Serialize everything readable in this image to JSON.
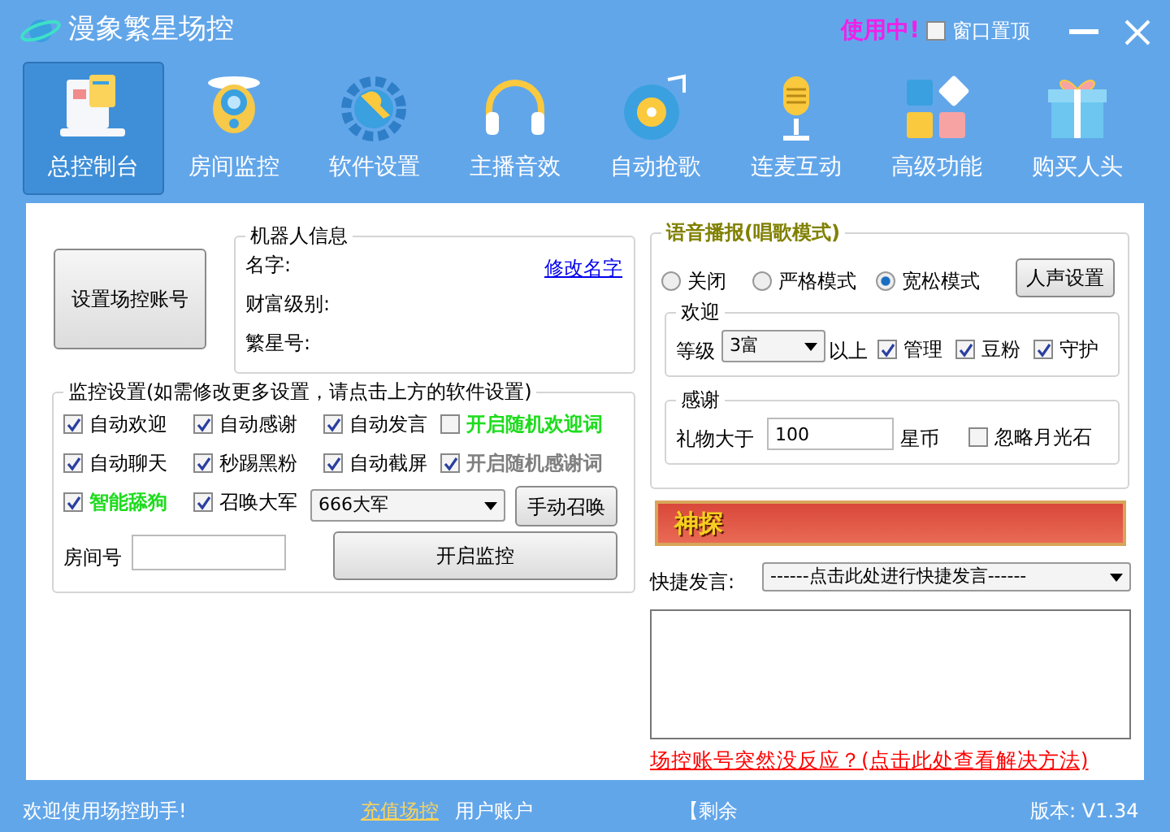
{
  "window": {
    "title": "漫象繁星场控",
    "status_badge": "使用中!",
    "pin_on_top": {
      "label": "窗口置顶",
      "checked": false
    }
  },
  "toolbar": [
    {
      "label": "总控制台",
      "selected": true
    },
    {
      "label": "房间监控",
      "selected": false
    },
    {
      "label": "软件设置",
      "selected": false
    },
    {
      "label": "主播音效",
      "selected": false
    },
    {
      "label": "自动抢歌",
      "selected": false
    },
    {
      "label": "连麦互动",
      "selected": false
    },
    {
      "label": "高级功能",
      "selected": false
    },
    {
      "label": "购买人头",
      "selected": false
    }
  ],
  "account_button": "设置场控账号",
  "robot_info": {
    "title": "机器人信息",
    "fields": [
      "名字:",
      "财富级别:",
      "繁星号:"
    ],
    "rename_link": "修改名字"
  },
  "monitor": {
    "title": "监控设置(如需修改更多设置，请点击上方的软件设置)",
    "options": [
      {
        "label": "自动欢迎",
        "checked": true,
        "highlight": false,
        "disabled": false
      },
      {
        "label": "自动感谢",
        "checked": true,
        "highlight": false,
        "disabled": false
      },
      {
        "label": "自动发言",
        "checked": true,
        "highlight": false,
        "disabled": false
      },
      {
        "label": "开启随机欢迎词",
        "checked": false,
        "highlight": true,
        "disabled": false
      },
      {
        "label": "自动聊天",
        "checked": true,
        "highlight": false,
        "disabled": false
      },
      {
        "label": "秒踢黑粉",
        "checked": true,
        "highlight": false,
        "disabled": false
      },
      {
        "label": "自动截屏",
        "checked": true,
        "highlight": false,
        "disabled": false
      },
      {
        "label": "开启随机感谢词",
        "checked": true,
        "highlight": false,
        "disabled": true
      },
      {
        "label": "智能舔狗",
        "checked": true,
        "highlight": true,
        "disabled": false
      },
      {
        "label": "召唤大军",
        "checked": true,
        "highlight": false,
        "disabled": false
      }
    ],
    "army_select": "666大军",
    "summon_button": "手动召唤",
    "room_label": "房间号",
    "start_button": "开启监控"
  },
  "voice": {
    "title": "语音播报(唱歌模式)",
    "modes": [
      {
        "label": "关闭",
        "selected": false
      },
      {
        "label": "严格模式",
        "selected": false
      },
      {
        "label": "宽松模式",
        "selected": true
      }
    ],
    "voice_button": "人声设置",
    "welcome": {
      "title": "欢迎",
      "level_label": "等级",
      "level_select": "3富",
      "above": "以上",
      "options": [
        {
          "label": "管理",
          "checked": true
        },
        {
          "label": "豆粉",
          "checked": true
        },
        {
          "label": "守护",
          "checked": true
        }
      ]
    },
    "thanks": {
      "title": "感谢",
      "gift_label": "礼物大于",
      "gift_value": "100",
      "unit": "星币",
      "ignore": {
        "label": "忽略月光石",
        "checked": false
      }
    }
  },
  "banner": {
    "title": "神探"
  },
  "quick": {
    "label": "快捷发言:",
    "select": "------点击此处进行快捷发言------"
  },
  "help_link": "场控账号突然没反应？(点击此处查看解决方法)",
  "status_bar": {
    "welcome": "欢迎使用场控助手!",
    "recharge": "充值场控",
    "account": "用户账户",
    "remaining": "【剩余",
    "version": "版本: V1.34"
  }
}
